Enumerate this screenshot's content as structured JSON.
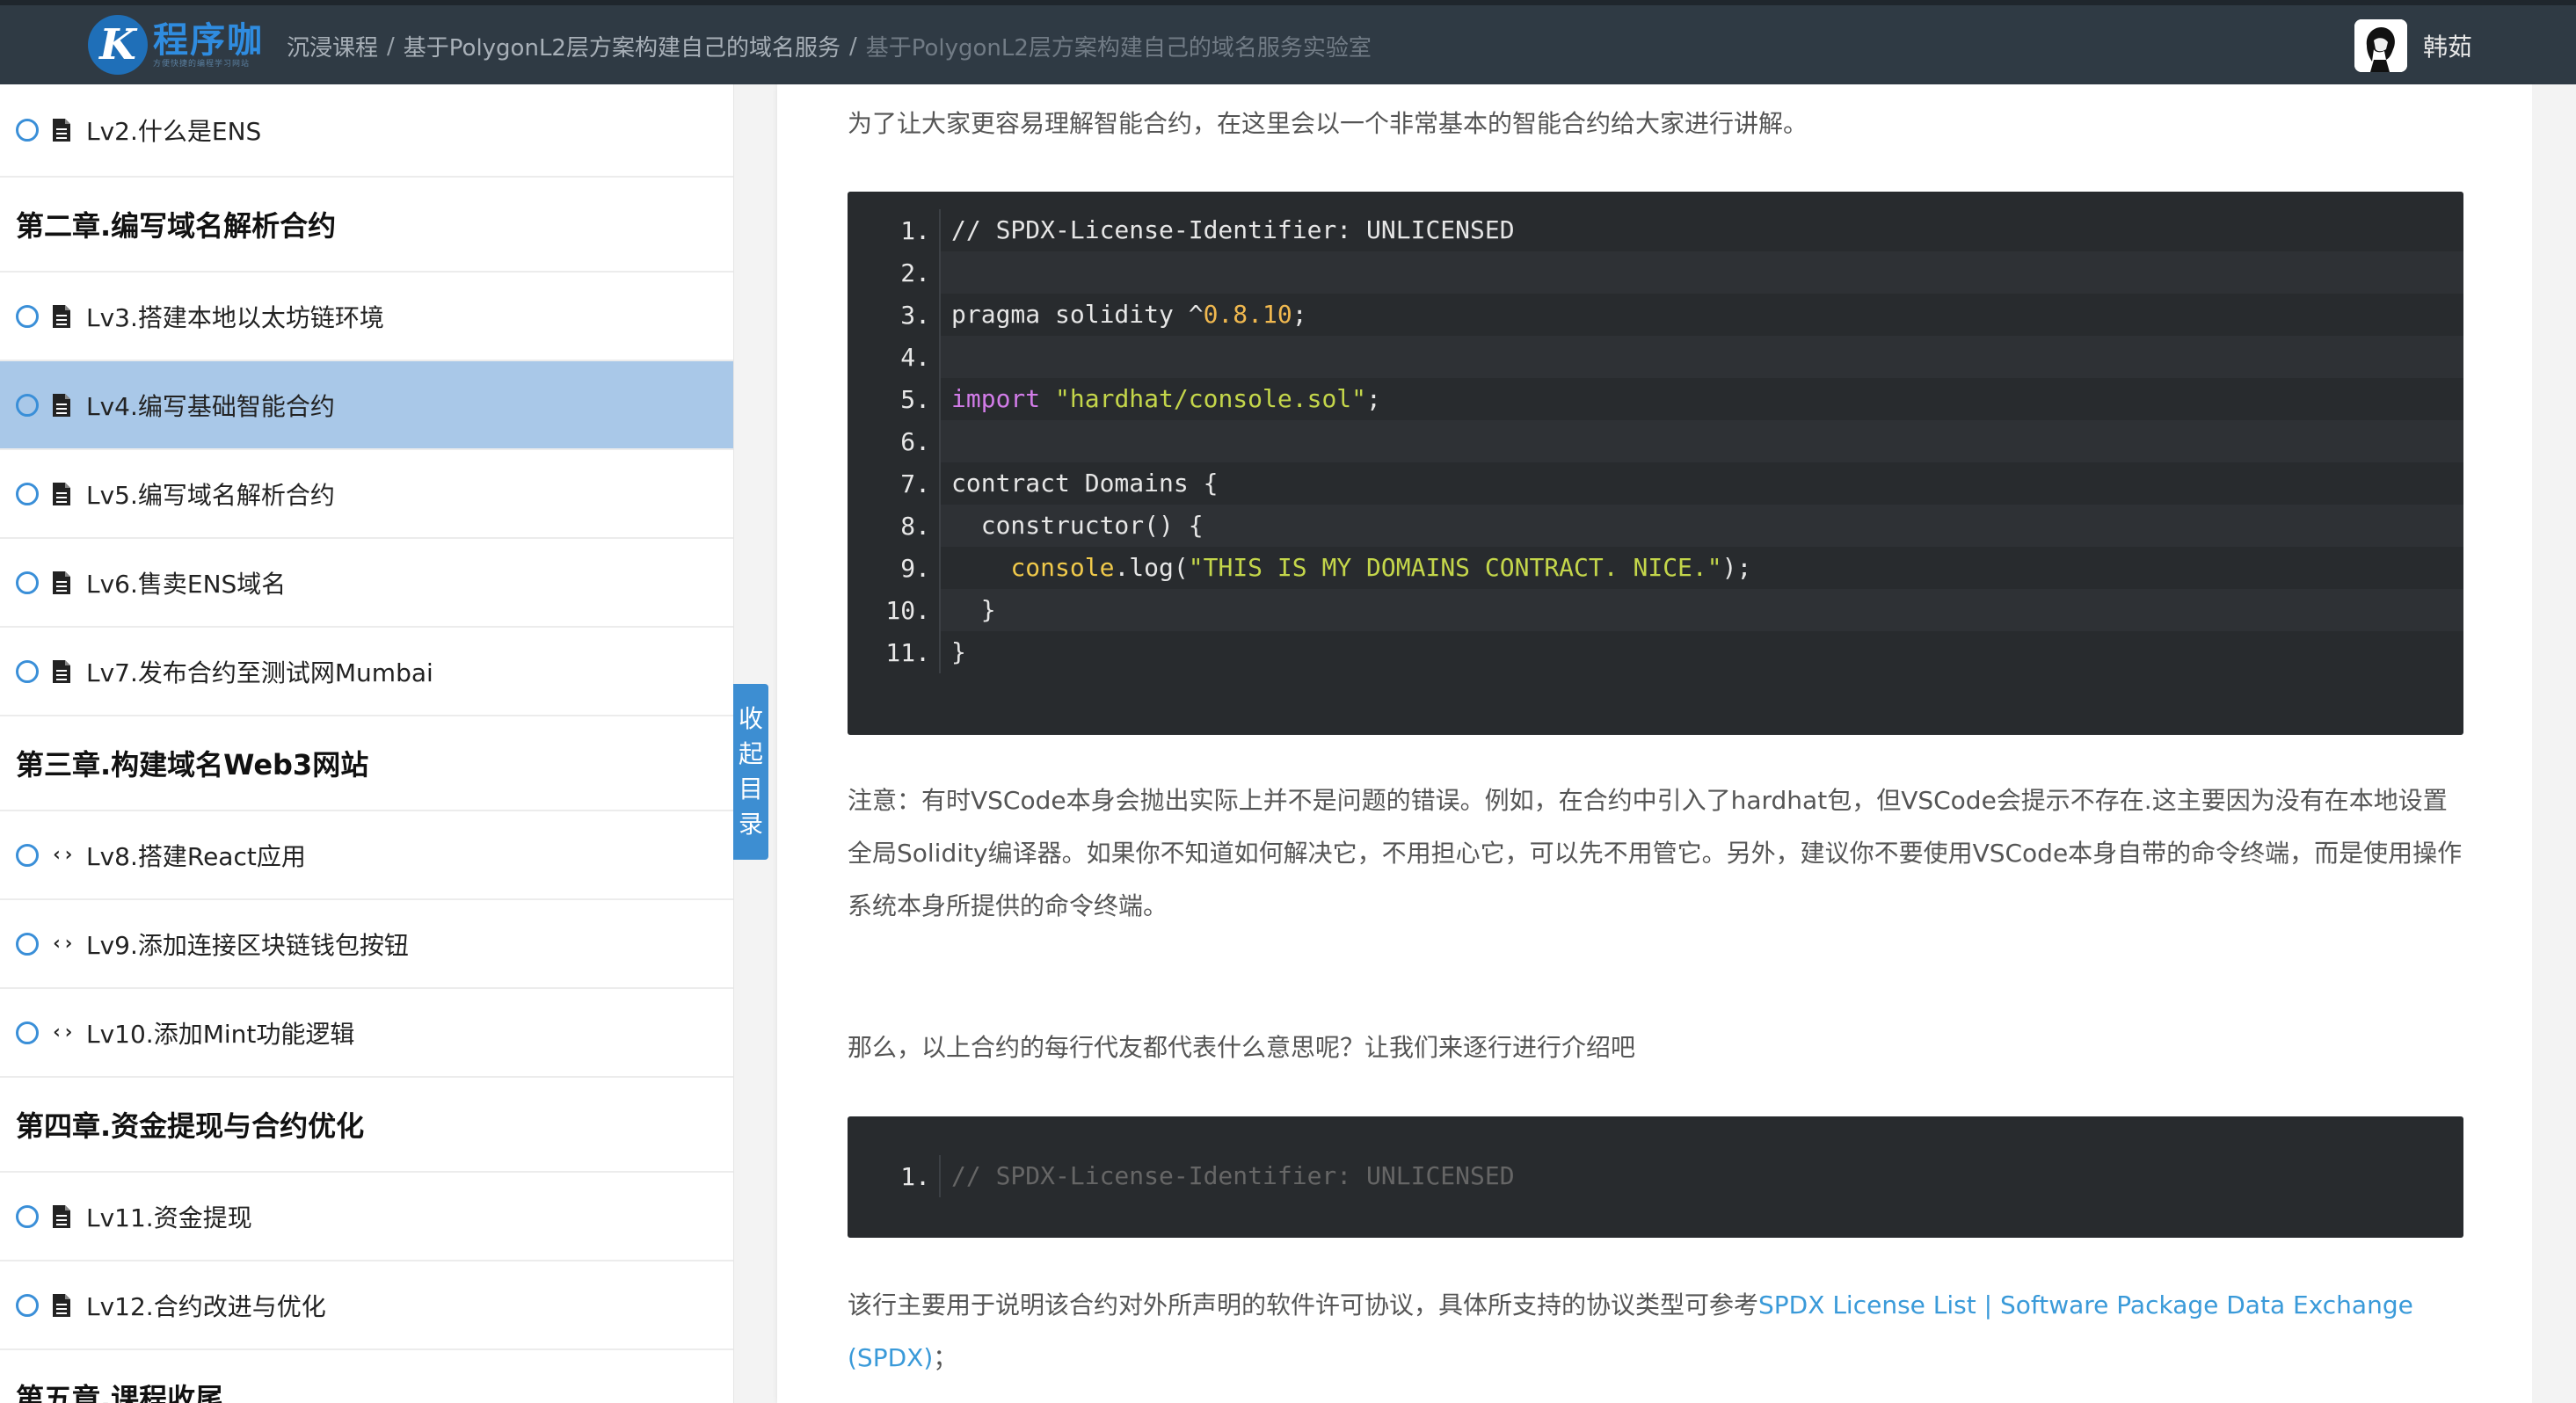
{
  "header": {
    "logo_mark": "K",
    "logo_text": "程序咖",
    "logo_subtitle": "方便快捷的编程学习网站",
    "breadcrumb": [
      "沉浸课程",
      "基于PolygonL2层方案构建自己的域名服务",
      "基于PolygonL2层方案构建自己的域名服务实验室"
    ],
    "user_name": "韩茹"
  },
  "sidebar": {
    "items": [
      {
        "type": "lesson",
        "icon": "doc-icon",
        "label": "Lv2.什么是ENS"
      },
      {
        "type": "chapter",
        "label": "第二章.编写域名解析合约"
      },
      {
        "type": "lesson",
        "icon": "doc-icon",
        "label": "Lv3.搭建本地以太坊链环境"
      },
      {
        "type": "lesson",
        "icon": "doc-icon",
        "label": "Lv4.编写基础智能合约",
        "active": true
      },
      {
        "type": "lesson",
        "icon": "doc-icon",
        "label": "Lv5.编写域名解析合约"
      },
      {
        "type": "lesson",
        "icon": "doc-icon",
        "label": "Lv6.售卖ENS域名"
      },
      {
        "type": "lesson",
        "icon": "doc-icon",
        "label": "Lv7.发布合约至测试网Mumbai"
      },
      {
        "type": "chapter",
        "label": "第三章.构建域名Web3网站"
      },
      {
        "type": "lesson",
        "icon": "code-icon",
        "label": "Lv8.搭建React应用"
      },
      {
        "type": "lesson",
        "icon": "code-icon",
        "label": "Lv9.添加连接区块链钱包按钮"
      },
      {
        "type": "lesson",
        "icon": "code-icon",
        "label": "Lv10.添加Mint功能逻辑"
      },
      {
        "type": "chapter",
        "label": "第四章.资金提现与合约优化"
      },
      {
        "type": "lesson",
        "icon": "doc-icon",
        "label": "Lv11.资金提现"
      },
      {
        "type": "lesson",
        "icon": "doc-icon",
        "label": "Lv12.合约改进与优化"
      },
      {
        "type": "chapter",
        "label": "第五章.课程收尾"
      }
    ],
    "collapse_label": [
      "收",
      "起",
      "目",
      "录"
    ]
  },
  "content": {
    "intro": "为了让大家更容易理解智能合约，在这里会以一个非常基本的智能合约给大家进行讲解。",
    "code1": [
      {
        "n": "1.",
        "parts": [
          [
            "c-comment",
            "// SPDX-License-Identifier: UNLICENSED"
          ]
        ]
      },
      {
        "n": "2.",
        "parts": []
      },
      {
        "n": "3.",
        "parts": [
          [
            "",
            "pragma solidity ^"
          ],
          [
            "c-num",
            "0.8.10"
          ],
          [
            "",
            ";"
          ]
        ]
      },
      {
        "n": "4.",
        "parts": []
      },
      {
        "n": "5.",
        "parts": [
          [
            "c-kw",
            "import"
          ],
          [
            "",
            " "
          ],
          [
            "c-str",
            "\"hardhat/console.sol\""
          ],
          [
            "",
            ";"
          ]
        ]
      },
      {
        "n": "6.",
        "parts": []
      },
      {
        "n": "7.",
        "parts": [
          [
            "",
            "contract Domains {"
          ]
        ]
      },
      {
        "n": "8.",
        "parts": [
          [
            "",
            "  constructor() {"
          ]
        ]
      },
      {
        "n": "9.",
        "parts": [
          [
            "",
            "    "
          ],
          [
            "c-fn",
            "console"
          ],
          [
            "",
            ".log("
          ],
          [
            "c-str",
            "\"THIS IS MY DOMAINS CONTRACT. NICE.\""
          ],
          [
            "",
            ");"
          ]
        ]
      },
      {
        "n": "10.",
        "parts": [
          [
            "",
            "  }"
          ]
        ]
      },
      {
        "n": "11.",
        "parts": [
          [
            "",
            "}"
          ]
        ]
      }
    ],
    "note": "注意：有时VSCode本身会抛出实际上并不是问题的错误。例如，在合约中引入了hardhat包，但VSCode会提示不存在.这主要因为没有在本地设置全局Solidity编译器。如果你不知道如何解决它，不用担心它，可以先不用管它。另外，建议你不要使用VSCode本身自带的命令终端，而是使用操作系统本身所提供的命令终端。",
    "question": "那么，以上合约的每行代友都代表什么意思呢？让我们来逐行进行介绍吧",
    "code2": [
      {
        "n": "1.",
        "parts": [
          [
            "faded",
            "// SPDX-License-Identifier: UNLICENSED"
          ]
        ]
      }
    ],
    "explain_prefix": "该行主要用于说明该合约对外所声明的软件许可协议，具体所支持的协议类型可参考",
    "explain_link": "SPDX License List | Software Package Data Exchange (SPDX)",
    "explain_suffix": "；"
  }
}
